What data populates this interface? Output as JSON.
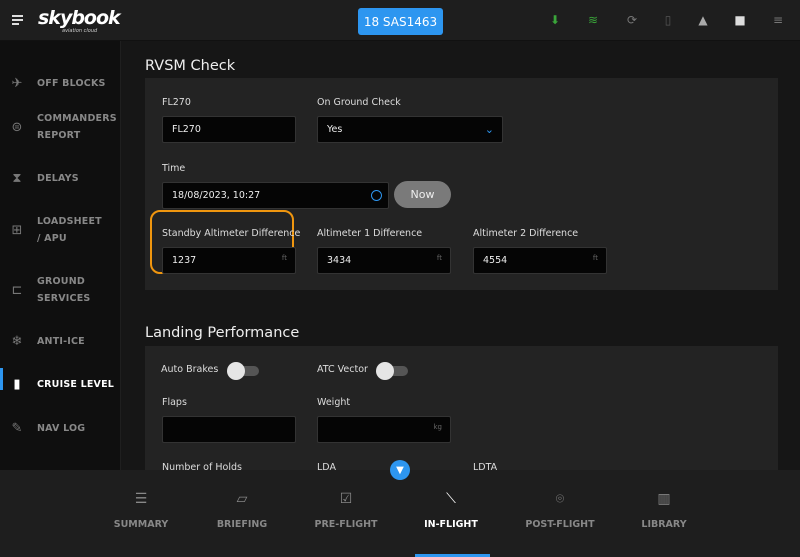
{
  "header": {
    "logo": "skybook",
    "logo_sub": "aviation cloud",
    "flight": "18 SAS1463",
    "icons": [
      "download-icon",
      "wifi-icon",
      "sync-icon",
      "bookmark-icon",
      "bell-icon",
      "camera-icon",
      "sliders-icon"
    ],
    "colors": {
      "accent": "#2d96f0",
      "online": "#3aa53a",
      "highlight": "#f0960f"
    }
  },
  "sidebar": {
    "items": [
      {
        "label": "OFF BLOCKS",
        "icon": "takeoff-icon"
      },
      {
        "label": "COMMANDERS REPORT",
        "icon": "list-circle-icon"
      },
      {
        "label": "DELAYS",
        "icon": "hourglass-icon"
      },
      {
        "label": "LOADSHEET / APU",
        "icon": "luggage-cart-icon"
      },
      {
        "label": "GROUND SERVICES",
        "icon": "fuel-truck-icon"
      },
      {
        "label": "ANTI-ICE",
        "icon": "snowflake-icon"
      },
      {
        "label": "CRUISE LEVEL",
        "icon": "ruler-icon",
        "active": true
      },
      {
        "label": "NAV LOG",
        "icon": "pencil-icon"
      }
    ]
  },
  "rvsm": {
    "title": "RVSM Check",
    "fl_label": "FL270",
    "fl_value": "FL270",
    "ground_label": "On Ground Check",
    "ground_value": "Yes",
    "time_label": "Time",
    "time_value": "18/08/2023, 10:27",
    "now": "Now",
    "standby_label": "Standby Altimeter Difference",
    "standby_value": "1237",
    "alt1_label": "Altimeter 1 Difference",
    "alt1_value": "3434",
    "alt2_label": "Altimeter 2 Difference",
    "alt2_value": "4554",
    "unit": "ft"
  },
  "landing": {
    "title": "Landing Performance",
    "auto_brakes": "Auto Brakes",
    "auto_brakes_on": false,
    "atc_vector": "ATC Vector",
    "atc_vector_on": false,
    "flaps": "Flaps",
    "weight": "Weight",
    "weight_unit": "kg",
    "holds": "Number of Holds",
    "lda": "LDA",
    "ldta": "LDTA"
  },
  "bottom_nav": [
    {
      "label": "SUMMARY",
      "icon": "list-icon"
    },
    {
      "label": "BRIEFING",
      "icon": "map-icon"
    },
    {
      "label": "PRE-FLIGHT",
      "icon": "checklist-icon"
    },
    {
      "label": "IN-FLIGHT",
      "icon": "route-icon",
      "active": true
    },
    {
      "label": "POST-FLIGHT",
      "icon": "location-check-icon"
    },
    {
      "label": "LIBRARY",
      "icon": "books-icon"
    }
  ]
}
